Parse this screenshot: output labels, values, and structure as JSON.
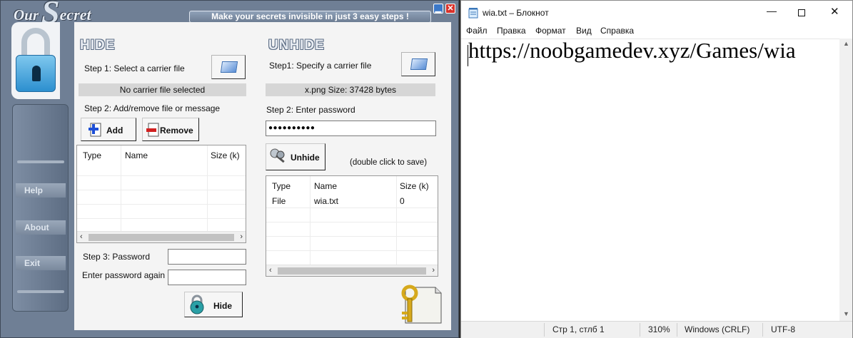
{
  "our_secret": {
    "logo_our": "Our",
    "logo_s": "S",
    "logo_ecret": "ecret",
    "banner": "Make your secrets invisible in just 3 easy steps !",
    "win_min": "▁",
    "win_close": "✕",
    "nav": {
      "help": "Help",
      "about": "About",
      "exit": "Exit"
    },
    "hide": {
      "title": "HIDE",
      "step1": "Step 1: Select a carrier file",
      "carrier_status": "No carrier file selected",
      "step2": "Step 2: Add/remove file or message",
      "add_label": "Add",
      "remove_label": "Remove",
      "columns": [
        "Type",
        "Name",
        "Size (k)"
      ],
      "step3": "Step 3: Password",
      "password_again": "Enter password again",
      "hide_label": "Hide"
    },
    "unhide": {
      "title": "UNHIDE",
      "step1": "Step1: Specify a carrier file",
      "carrier_status": "x.png  Size: 37428 bytes",
      "step2": "Step 2: Enter password",
      "password_value": "●●●●●●●●●●",
      "unhide_label": "Unhide",
      "hint": "(double click to save)",
      "columns": [
        "Type",
        "Name",
        "Size (k)"
      ],
      "rows": [
        {
          "type": "File",
          "name": "wia.txt",
          "size": "0"
        }
      ]
    }
  },
  "notepad": {
    "title": "wia.txt – Блокнот",
    "menu": [
      "Файл",
      "Правка",
      "Формат",
      "Вид",
      "Справка"
    ],
    "content": "https://noobgamedev.xyz/Games/wia",
    "status": {
      "position": "Стр 1, стлб 1",
      "zoom": "310%",
      "line_endings": "Windows (CRLF)",
      "encoding": "UTF-8"
    }
  },
  "colors": {
    "os_frame": "#6f7f95",
    "os_content": "#f4f4f4",
    "lock_blue": "#2c8fcf"
  }
}
